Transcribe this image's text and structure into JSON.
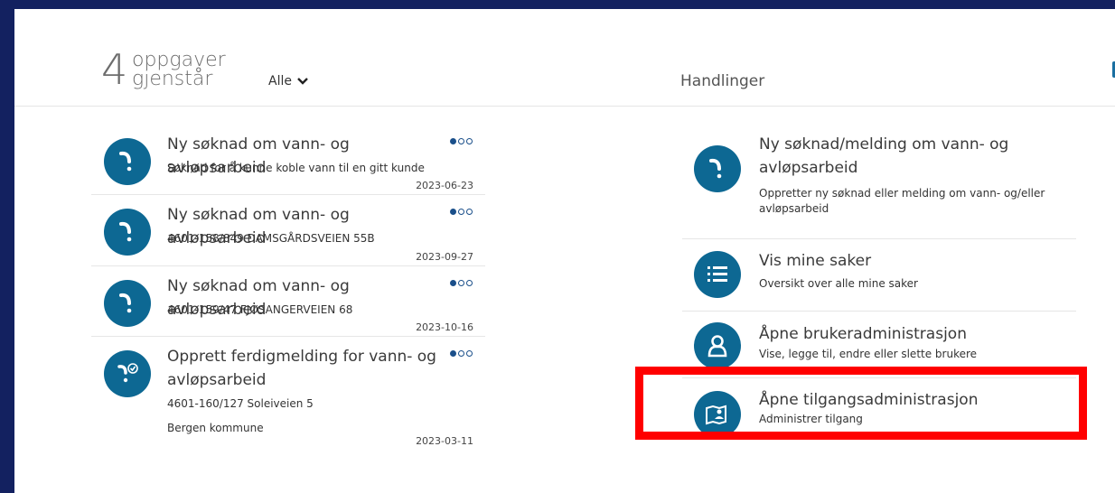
{
  "tasks_header": {
    "count": "4",
    "label_line1": "oppgaver",
    "label_line2": "gjenstår",
    "filter_label": "Alle"
  },
  "actions_header": {
    "title": "Handlinger"
  },
  "tasks": [
    {
      "title": "Ny søknad om vann- og avløpsarbeid",
      "subtitle": "Søknad for å kunne koble vann til en gitt kunde",
      "extra": "",
      "date": "2023-06-23",
      "icon": "water-pipe-icon"
    },
    {
      "title": "Ny søknad om vann- og avløpsarbeid",
      "subtitle": "4601-158/849 DAMSGÅRDSVEIEN 55B",
      "extra": "",
      "date": "2023-09-27",
      "icon": "water-pipe-icon"
    },
    {
      "title": "Ny søknad om vann- og avløpsarbeid",
      "subtitle": "4601-159/47 FJØSANGERVEIEN 68",
      "extra": "",
      "date": "2023-10-16",
      "icon": "water-pipe-icon"
    },
    {
      "title": "Opprett ferdigmelding for vann- og avløpsarbeid",
      "subtitle": "4601-160/127 Soleiveien 5",
      "extra": "Bergen kommune",
      "date": "2023-03-11",
      "icon": "water-pipe-check-icon"
    }
  ],
  "actions": [
    {
      "title": "Ny søknad/melding om vann- og avløpsarbeid",
      "subtitle": "Oppretter ny søknad eller melding om vann- og/eller avløpsarbeid",
      "icon": "water-pipe-icon"
    },
    {
      "title": "Vis mine saker",
      "subtitle": "Oversikt over alle mine saker",
      "icon": "list-icon"
    },
    {
      "title": "Åpne brukeradministrasjon",
      "subtitle": "Vise, legge til, endre eller slette brukere",
      "icon": "user-icon"
    },
    {
      "title": "Åpne tilgangsadministrasjon",
      "subtitle": "Administrer tilgang",
      "icon": "access-map-icon"
    }
  ],
  "colors": {
    "background": "#132160",
    "accent": "#0d6893",
    "highlight": "#ff0000"
  }
}
